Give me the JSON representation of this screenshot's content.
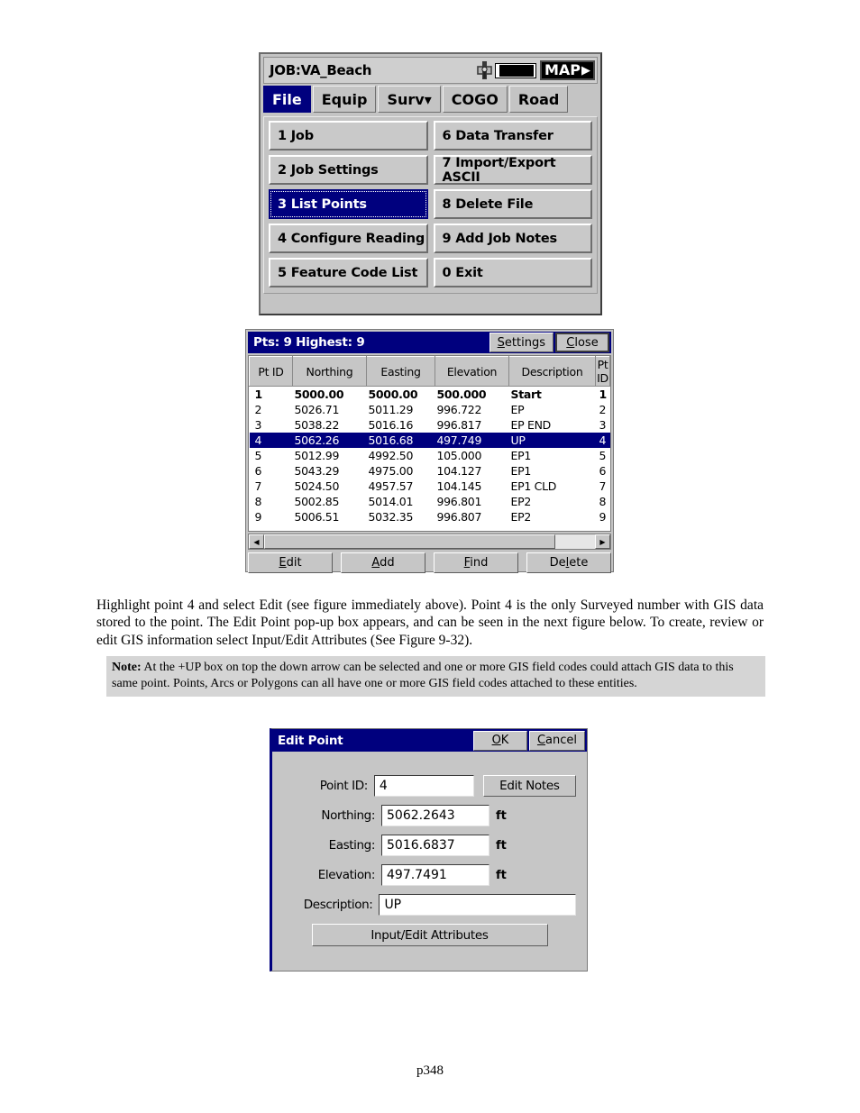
{
  "menu_screen": {
    "job_title": "JOB:VA_Beach",
    "status_icons": {
      "satellite": "satellite-icon",
      "battery": "battery-icon"
    },
    "map_button": {
      "label": "MAP",
      "arrow": "▶"
    },
    "tabs": [
      {
        "label": "File",
        "active": true
      },
      {
        "label": "Equip",
        "active": false
      },
      {
        "label": "Surv▾",
        "active": false
      },
      {
        "label": "COGO",
        "active": false
      },
      {
        "label": "Road",
        "active": false
      }
    ],
    "keys": [
      {
        "label": "1 Job",
        "selected": false
      },
      {
        "label": "6 Data Transfer",
        "selected": false
      },
      {
        "label": "2 Job Settings",
        "selected": false
      },
      {
        "label": "7 Import/Export ASCII",
        "selected": false
      },
      {
        "label": "3 List Points",
        "selected": true
      },
      {
        "label": "8 Delete File",
        "selected": false
      },
      {
        "label": "4 Configure Reading",
        "selected": false
      },
      {
        "label": "9 Add Job Notes",
        "selected": false
      },
      {
        "label": "5 Feature Code List",
        "selected": false
      },
      {
        "label": "0 Exit",
        "selected": false
      }
    ]
  },
  "list_dialog": {
    "title": "Pts: 9 Highest: 9",
    "settings_button": "Settings",
    "close_button": "Close",
    "columns": [
      "Pt ID",
      "Northing",
      "Easting",
      "Elevation",
      "Description",
      "Pt ID"
    ],
    "rows": [
      {
        "id": "1",
        "northing": "5000.00",
        "easting": "5000.00",
        "elevation": "500.000",
        "description": "Start",
        "id2": "1",
        "bold": true,
        "selected": false
      },
      {
        "id": "2",
        "northing": "5026.71",
        "easting": "5011.29",
        "elevation": "996.722",
        "description": "EP",
        "id2": "2",
        "bold": false,
        "selected": false
      },
      {
        "id": "3",
        "northing": "5038.22",
        "easting": "5016.16",
        "elevation": "996.817",
        "description": "EP END",
        "id2": "3",
        "bold": false,
        "selected": false
      },
      {
        "id": "4",
        "northing": "5062.26",
        "easting": "5016.68",
        "elevation": "497.749",
        "description": "UP",
        "id2": "4",
        "bold": false,
        "selected": true
      },
      {
        "id": "5",
        "northing": "5012.99",
        "easting": "4992.50",
        "elevation": "105.000",
        "description": "EP1",
        "id2": "5",
        "bold": false,
        "selected": false
      },
      {
        "id": "6",
        "northing": "5043.29",
        "easting": "4975.00",
        "elevation": "104.127",
        "description": "EP1",
        "id2": "6",
        "bold": false,
        "selected": false
      },
      {
        "id": "7",
        "northing": "5024.50",
        "easting": "4957.57",
        "elevation": "104.145",
        "description": "EP1 CLD",
        "id2": "7",
        "bold": false,
        "selected": false
      },
      {
        "id": "8",
        "northing": "5002.85",
        "easting": "5014.01",
        "elevation": "996.801",
        "description": "EP2",
        "id2": "8",
        "bold": false,
        "selected": false
      },
      {
        "id": "9",
        "northing": "5006.51",
        "easting": "5032.35",
        "elevation": "996.807",
        "description": "EP2",
        "id2": "9",
        "bold": false,
        "selected": false
      }
    ],
    "scroll_left_icon": "◀",
    "scroll_right_icon": "▶",
    "buttons": [
      {
        "label": "Edit",
        "accel": "E"
      },
      {
        "label": "Add",
        "accel": "A"
      },
      {
        "label": "Find",
        "accel": "F"
      },
      {
        "label": "Delete",
        "accel": "l"
      }
    ]
  },
  "body_paragraph": "Highlight point 4 and select Edit (see figure immediately above). Point 4 is the only Surveyed number with GIS data stored to the point.  The Edit Point pop-up box appears, and can be seen in the next figure below.  To create, review or edit GIS information select Input/Edit Attributes (See Figure 9-32).",
  "note": {
    "label": "Note:",
    "text": "At the +UP box on top the down arrow can be selected and one or more GIS  field codes could attach GIS  data to this same point.  Points, Arcs or Polygons can all have one or more GIS  field codes attached to these entities."
  },
  "edit_dialog": {
    "title": "Edit Point",
    "ok_button": "OK",
    "cancel_button": "Cancel",
    "fields": [
      {
        "label": "Point ID:",
        "value": "4",
        "unit": ""
      },
      {
        "label": "Northing:",
        "value": "5062.2643",
        "unit": "ft"
      },
      {
        "label": "Easting:",
        "value": "5016.6837",
        "unit": "ft"
      },
      {
        "label": "Elevation:",
        "value": "497.7491",
        "unit": "ft"
      },
      {
        "label": "Description:",
        "value": "UP",
        "unit": ""
      }
    ],
    "edit_notes_button": "Edit Notes",
    "attributes_button": "Input/Edit Attributes"
  },
  "footer": {
    "page": "p348"
  },
  "colors": {
    "dialog_title_bg": "#00007e",
    "selection_bg": "#00007e",
    "panel_bg": "#c6c6c6",
    "note_bg": "#d5d5d5",
    "field_bg": "#ffffff"
  }
}
